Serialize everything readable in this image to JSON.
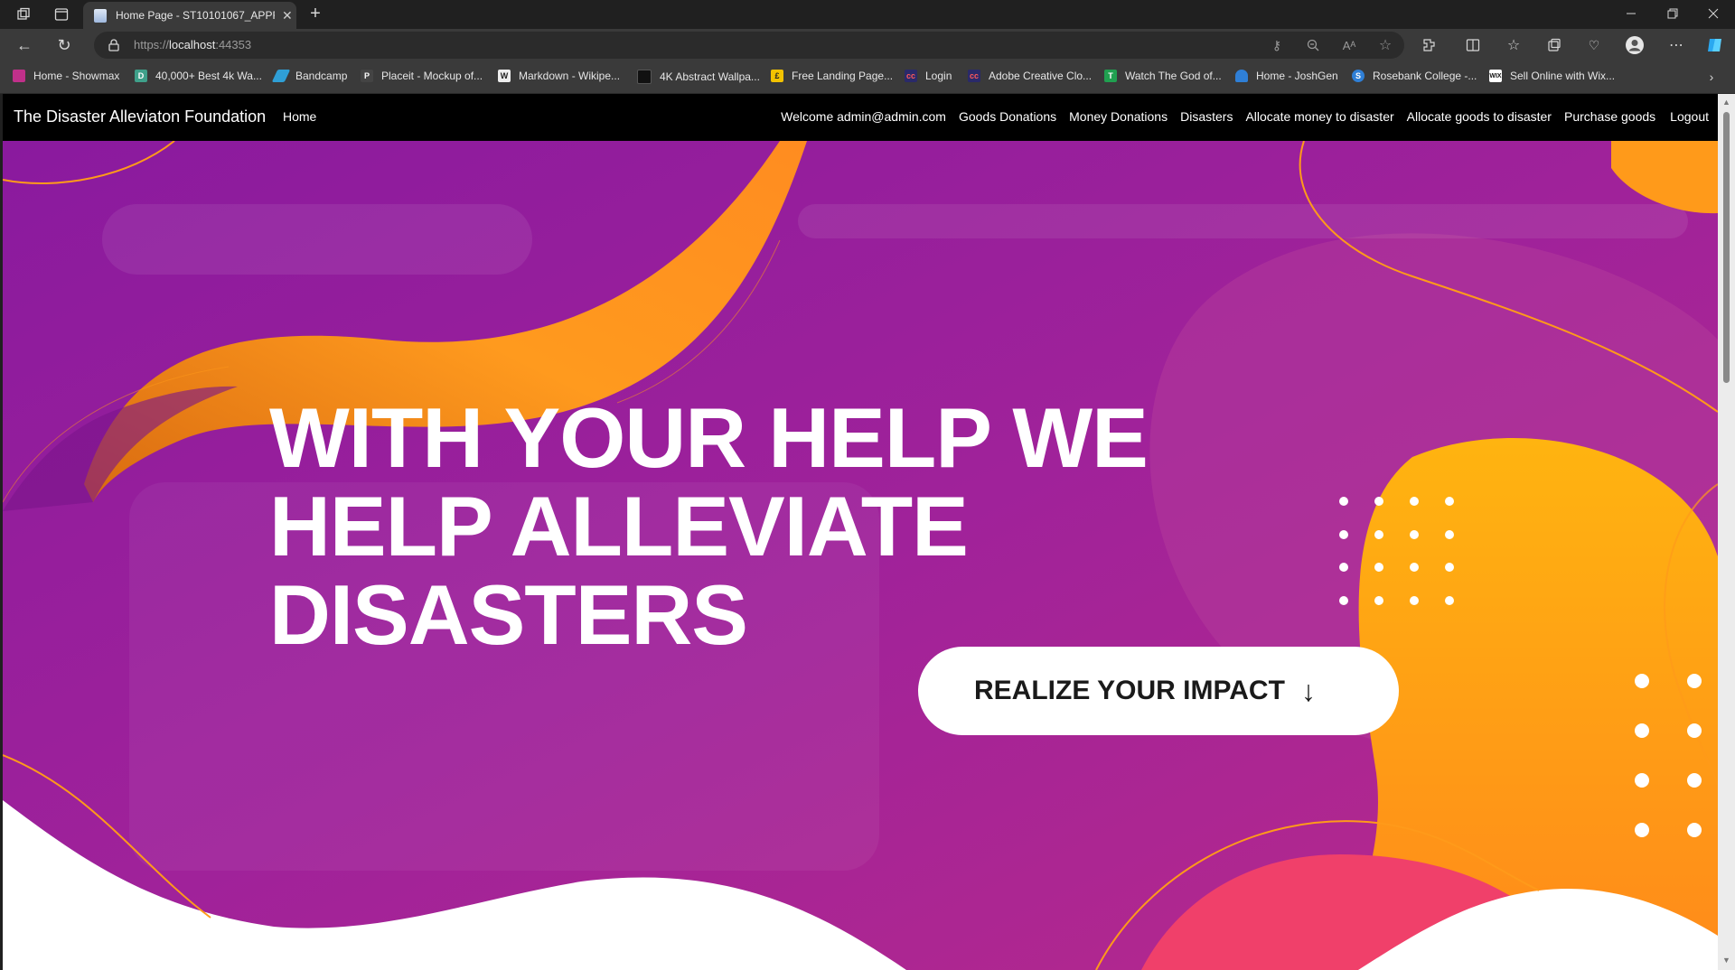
{
  "browser": {
    "tab_title": "Home Page - ST10101067_APPR",
    "url_scheme": "https://",
    "url_host": "localhost",
    "url_port": ":44353",
    "bookmarks": [
      {
        "label": "Home - Showmax",
        "color": "#c0308a"
      },
      {
        "label": "40,000+ Best 4k Wa...",
        "color": "#3fa08a"
      },
      {
        "label": "Bandcamp",
        "color": "#2f9fd6"
      },
      {
        "label": "Placeit - Mockup of...",
        "color": "#444444"
      },
      {
        "label": "Markdown - Wikipe...",
        "color": "#eeeeee"
      },
      {
        "label": "4K Abstract Wallpa...",
        "color": "#111111"
      },
      {
        "label": "Free Landing Page...",
        "color": "#f2c200"
      },
      {
        "label": "Login",
        "color": "#2a2a6a"
      },
      {
        "label": "Adobe Creative Clo...",
        "color": "#2a2a6a"
      },
      {
        "label": "Watch The God of...",
        "color": "#20a050"
      },
      {
        "label": "Home - JoshGen",
        "color": "#2f7fd6"
      },
      {
        "label": "Rosebank College -...",
        "color": "#2f7fd6"
      },
      {
        "label": "Sell Online with Wix...",
        "color": "#ffffff"
      }
    ]
  },
  "navbar": {
    "brand": "The Disaster Alleviaton Foundation",
    "home": "Home",
    "items": [
      "Welcome admin@admin.com",
      "Goods Donations",
      "Money Donations",
      "Disasters",
      "Allocate money to disaster",
      "Allocate goods to disaster",
      "Purchase goods",
      "Logout"
    ]
  },
  "hero": {
    "headline_1": "WITH YOUR HELP WE",
    "headline_2": "HELP ALLEVIATE",
    "headline_3": "DISASTERS",
    "cta_label": "REALIZE YOUR IMPACT",
    "cta_arrow": "↓",
    "colors": {
      "purple": "#9c1e96",
      "orange": "#ff9a1a",
      "pink": "#f0406a"
    }
  }
}
